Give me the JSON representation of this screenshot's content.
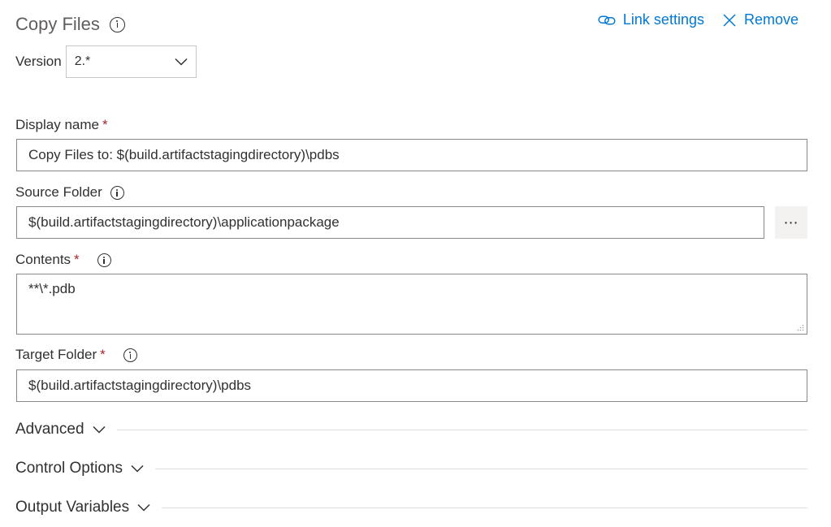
{
  "header": {
    "title": "Copy Files",
    "link_settings": "Link settings",
    "remove": "Remove"
  },
  "version": {
    "label": "Version",
    "value": "2.*"
  },
  "fields": {
    "display_name": {
      "label": "Display name",
      "required": "*",
      "value": "Copy Files to: $(build.artifactstagingdirectory)\\pdbs"
    },
    "source_folder": {
      "label": "Source Folder",
      "value": "$(build.artifactstagingdirectory)\\applicationpackage",
      "browse": "⋯"
    },
    "contents": {
      "label": "Contents",
      "required": "*",
      "value": "**\\*.pdb"
    },
    "target_folder": {
      "label": "Target Folder",
      "required": "*",
      "value": "$(build.artifactstagingdirectory)\\pdbs"
    }
  },
  "sections": {
    "advanced": "Advanced",
    "control_options": "Control Options",
    "output_variables": "Output Variables"
  },
  "colors": {
    "accent": "#0078d4",
    "required": "#a4262c",
    "border": "#8a8886"
  },
  "icons": [
    "info-icon",
    "link-icon",
    "close-icon",
    "chevron-down-icon",
    "resize-grip-icon"
  ]
}
